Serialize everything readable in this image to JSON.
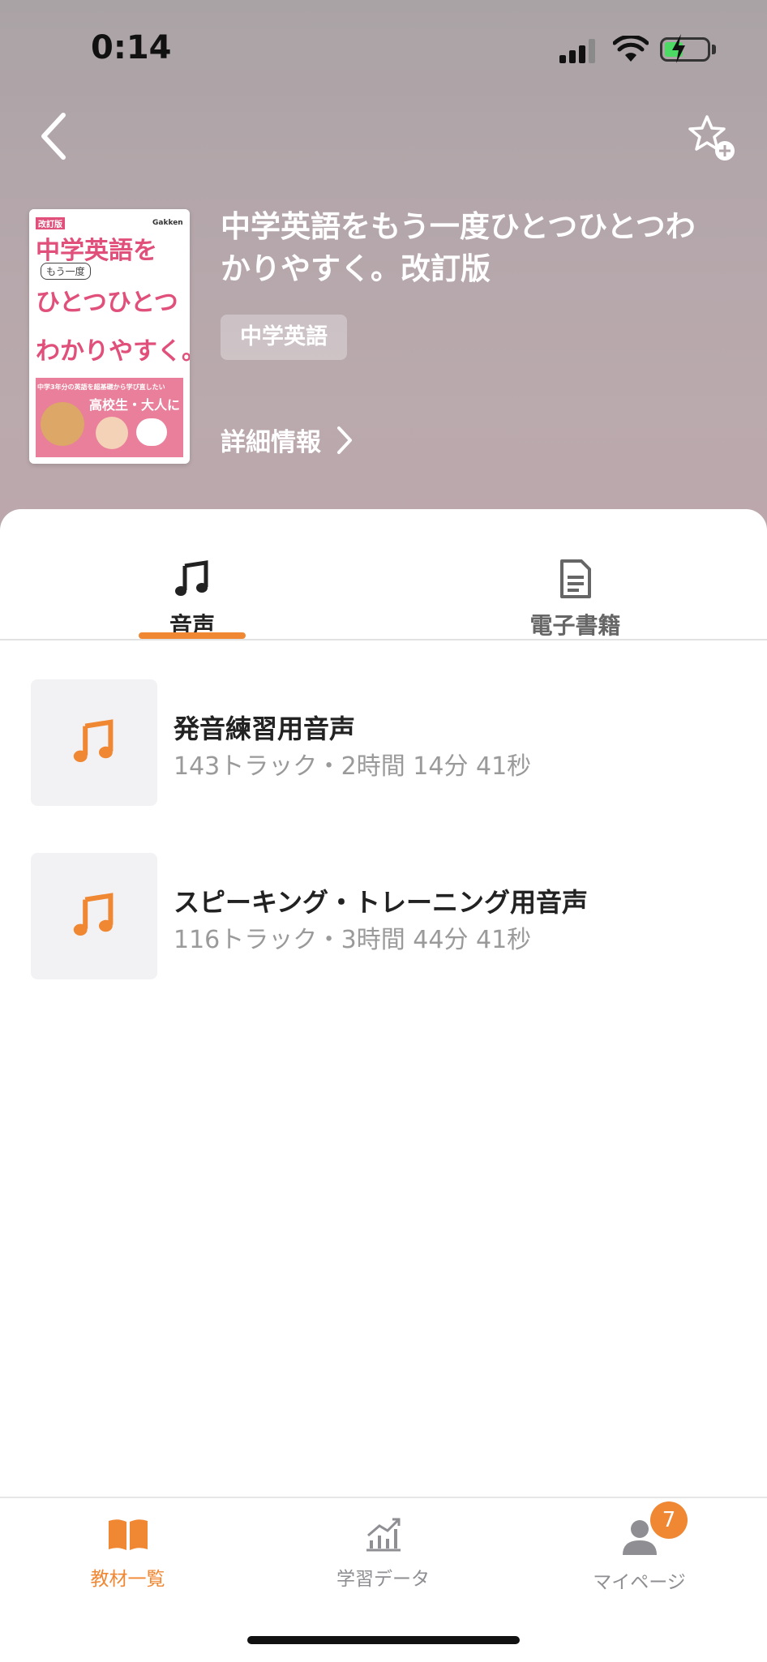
{
  "status_bar": {
    "time": "0:14"
  },
  "book": {
    "title": "中学英語をもう一度ひとつひとつわかりやすく。改訂版",
    "category": "中学英語",
    "detail_link": "詳細情報",
    "cover": {
      "edition": "改訂版",
      "line1": "中学英語を",
      "line2": "もう一度",
      "line3": "ひとつひとつ",
      "line4": "わかりやすく。",
      "tagline": "中学3年分の英語を超基礎から学び直したい",
      "audience": "高校生・大人に",
      "brand": "Gakken"
    }
  },
  "tabs": [
    {
      "label": "音声",
      "icon": "music-note-icon",
      "active": true
    },
    {
      "label": "電子書籍",
      "icon": "document-icon",
      "active": false
    }
  ],
  "tracks": [
    {
      "title": "発音練習用音声",
      "meta": "143トラック・2時間 14分 41秒"
    },
    {
      "title": "スピーキング・トレーニング用音声",
      "meta": "116トラック・3時間 44分 41秒"
    }
  ],
  "bottom_nav": [
    {
      "label": "教材一覧",
      "icon": "book-icon",
      "active": true
    },
    {
      "label": "学習データ",
      "icon": "chart-icon",
      "active": false
    },
    {
      "label": "マイページ",
      "icon": "person-icon",
      "active": false,
      "badge": "7"
    }
  ],
  "colors": {
    "accent": "#f08732",
    "inactive": "#8e8e93",
    "text": "#222222"
  }
}
